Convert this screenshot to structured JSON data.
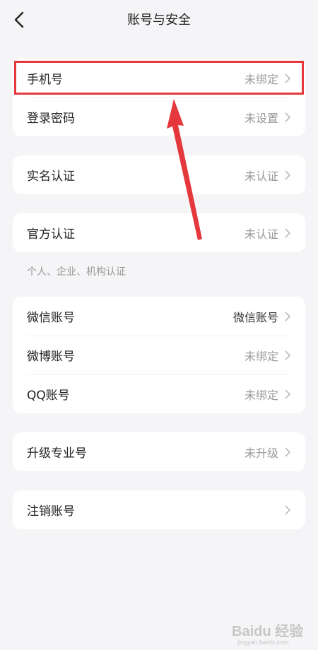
{
  "header": {
    "title": "账号与安全"
  },
  "groups": [
    {
      "rows": [
        {
          "label": "手机号",
          "value": "未绑定"
        },
        {
          "label": "登录密码",
          "value": "未设置"
        }
      ]
    },
    {
      "rows": [
        {
          "label": "实名认证",
          "value": "未认证"
        }
      ]
    },
    {
      "rows": [
        {
          "label": "官方认证",
          "value": "未认证"
        }
      ],
      "hint": "个人、企业、机构认证"
    },
    {
      "rows": [
        {
          "label": "微信账号",
          "value": "微信账号"
        },
        {
          "label": "微博账号",
          "value": "未绑定"
        },
        {
          "label": "QQ账号",
          "value": "未绑定"
        }
      ]
    },
    {
      "rows": [
        {
          "label": "升级专业号",
          "value": "未升级"
        }
      ]
    },
    {
      "rows": [
        {
          "label": "注销账号",
          "value": ""
        }
      ]
    }
  ],
  "watermark": {
    "text": "Baidu 经验",
    "subtext": "jingyan.baidu.com"
  },
  "colors": {
    "background": "#f5f5f7",
    "highlight": "#e4383c",
    "muted": "#999999"
  }
}
